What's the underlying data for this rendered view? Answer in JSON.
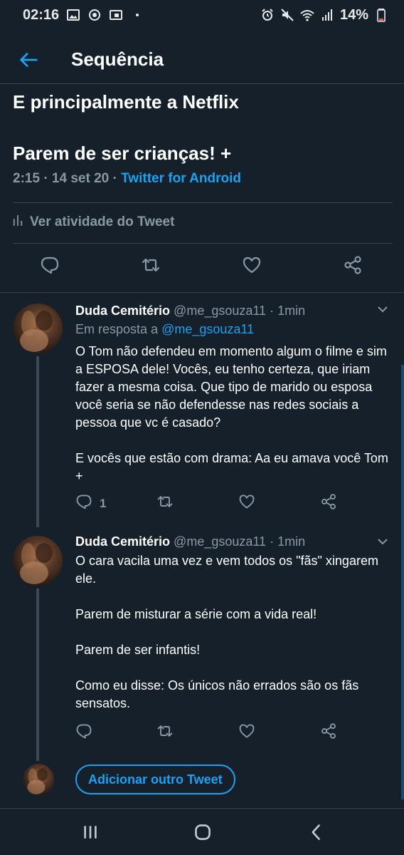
{
  "status_bar": {
    "time": "02:16",
    "battery": "14%",
    "icons": [
      "image-icon",
      "sync-icon",
      "lock-screen-icon",
      "dot-icon",
      "alarm-icon",
      "mute-icon",
      "wifi-icon",
      "signal-icon",
      "battery-icon"
    ]
  },
  "header": {
    "title": "Sequência",
    "back_icon": "back-arrow-icon"
  },
  "main_tweet": {
    "line1": "E principalmente a Netflix",
    "line2": "Parem de ser crianças! +",
    "time": "2:15",
    "date": "14 set 20",
    "source": "Twitter for Android",
    "activity_label": "Ver atividade do Tweet",
    "actions": [
      "reply-icon",
      "retweet-icon",
      "like-icon",
      "share-icon"
    ]
  },
  "replies": [
    {
      "name": "Duda Cemitério",
      "handle": "@me_gsouza11",
      "time": "1min",
      "reply_prefix": "Em resposta a",
      "reply_mention": "@me_gsouza11",
      "text": "O Tom não defendeu em momento algum o filme e sim a ESPOSA dele! Vocês, eu tenho certeza, que iriam fazer a mesma coisa. Que tipo de marido ou esposa você seria se não defendesse nas redes sociais a pessoa que vc é casado?\n\nE vocês que estão com drama: Aa eu amava você Tom +",
      "reply_count": "1"
    },
    {
      "name": "Duda Cemitério",
      "handle": "@me_gsouza11",
      "time": "1min",
      "text": "O cara vacila uma vez e vem todos os \"fãs\" xingarem ele.\n\nParem de misturar a série com a vida real!\n\nParem de ser infantis!\n\nComo eu disse: Os únicos não errados são os fãs sensatos.",
      "reply_count": ""
    }
  ],
  "compose": {
    "label": "Adicionar outro Tweet"
  },
  "nav_bar": {
    "icons": [
      "recent-apps-icon",
      "home-icon",
      "back-icon"
    ]
  },
  "colors": {
    "background": "#15202b",
    "accent": "#1da1f2",
    "secondary_text": "#8899a6",
    "border": "#38444d"
  }
}
